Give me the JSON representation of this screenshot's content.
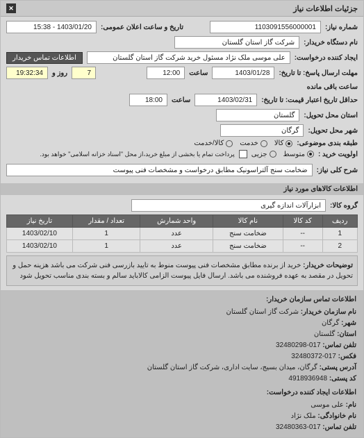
{
  "header": {
    "title": "جزئیات اطلاعات نیاز",
    "close": "✕"
  },
  "info": {
    "request_no_label": "شماره نیاز:",
    "request_no": "1103091556000001",
    "announce_label": "تاریخ و ساعت اعلان عمومی:",
    "announce": "1403/01/20 - 15:38",
    "buyer_org_label": "نام دستگاه خریدار:",
    "buyer_org": "شرکت گاز استان گلستان",
    "requester_label": "ایجاد کننده درخواست:",
    "requester": "علی موسی ملک نژاد مسئول خرید شرکت گاز استان گلستان",
    "contact_btn": "اطلاعات تماس خریدار",
    "resp_deadline_label": "مهلت ارسال پاسخ: تا تاریخ:",
    "resp_date": "1403/01/28",
    "time_label": "ساعت",
    "resp_time": "12:00",
    "remain_days": "7",
    "remain_day_label": "روز و",
    "remain_time": "19:32:34",
    "remain_time_label": "ساعت باقی مانده",
    "valid_label": "حداقل تاریخ اعتبار قیمت: تا تاریخ:",
    "valid_date": "1403/02/31",
    "valid_time": "18:00",
    "delivery_prov_label": "استان محل تحویل:",
    "delivery_prov": "گلستان",
    "delivery_city_label": "شهر محل تحویل:",
    "delivery_city": "گرگان",
    "pkg_label": "طبقه بندی موضوعی:",
    "rad_goods": "کالا",
    "rad_service": "خدمت",
    "rad_both": "کالا/خدمت",
    "buy_priority_label": "اولویت خرید :",
    "rad_mid": "متوسط",
    "rad_partial": "جزیی",
    "partial_note": "پرداخت تمام یا بخشی از مبلغ خرید،از محل \"اسناد خزانه اسلامی\" خواهد بود.",
    "need_desc_label": "شرح کلی نیاز:",
    "need_desc": "ضخامت سنج آلتراسونیک مطابق درخواست و مشخصات فنی پیوست"
  },
  "goods": {
    "heading": "اطلاعات کالاهای مورد نیاز",
    "group_label": "گروه کالا:",
    "group": "ابزارآلات اندازه گیری",
    "cols": {
      "row": "ردیف",
      "code": "کد کالا",
      "name": "نام کالا",
      "unit": "واحد شمارش",
      "qty": "تعداد / مقدار",
      "due": "تاریخ نیاز"
    },
    "rows": [
      {
        "n": "1",
        "code": "--",
        "name": "ضخامت سنج",
        "unit": "عدد",
        "qty": "1",
        "due": "1403/02/10"
      },
      {
        "n": "2",
        "code": "--",
        "name": "ضخامت سنج",
        "unit": "عدد",
        "qty": "1",
        "due": "1403/02/10"
      }
    ],
    "buyer_note_label": "توضیحات خریدار:",
    "buyer_note": "خرید از برنده مطابق مشخصات فنی پیوست منوط به تایید بازرسی فنی شرکت می باشد هزینه حمل و تحویل در مقصد به عهده فروشنده می باشد. ارسال فایل پیوست الزامی کالاباید سالم و بسته بندی مناسب تحویل شود"
  },
  "contact": {
    "heading1": "اطلاعات تماس سازمان خریدار:",
    "org_label": "نام سازمان خریدار:",
    "org": "شرکت گاز استان گلستان",
    "city_label": "شهر:",
    "city": "گرگان",
    "prov_label": "استان:",
    "prov": "گلستان",
    "tel_label": "تلفن تماس:",
    "tel": "017-32480298",
    "fax_label": "فکس:",
    "fax": "017-32480372",
    "addr_label": "آدرس پستی:",
    "addr": "گرگان، میدان بسیج، سایت اداری، شرکت گاز استان گلستان",
    "zip_label": "کد پستی:",
    "zip": "4918936948",
    "heading2": "اطلاعات ایجاد کننده درخواست:",
    "fname_label": "نام:",
    "fname": "علی موسی",
    "lname_label": "نام خانوادگی:",
    "lname": "ملک نژاد",
    "tel2_label": "تلفن تماس:",
    "tel2": "017-32480363"
  }
}
